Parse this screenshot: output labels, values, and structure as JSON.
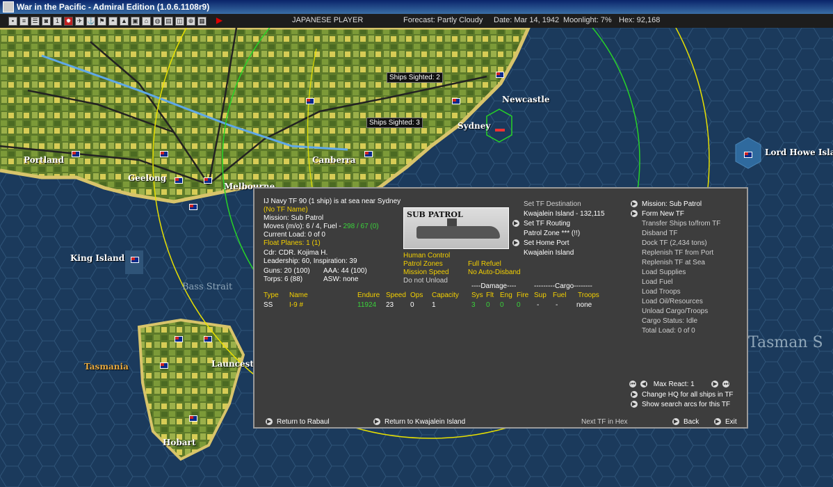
{
  "window": {
    "title": "War in the Pacific - Admiral Edition (1.0.6.1108r9)"
  },
  "toolbar": {
    "player": "JAPANESE PLAYER",
    "forecast": "Forecast: Partly Cloudy",
    "date": "Date: Mar 14, 1942",
    "moonlight": "Moonlight: 7%",
    "hex": "Hex: 92,168",
    "icons": [
      "info-icon",
      "report-icon",
      "list-icon",
      "group-icon",
      "one-icon",
      "flag-jp-icon",
      "plane-icon",
      "ship-icon",
      "intel-icon",
      "radar-icon",
      "base-icon",
      "factory-icon",
      "hq-icon",
      "globe-icon",
      "display-icon",
      "ob-icon",
      "zoom-icon",
      "save-icon",
      "play-icon"
    ]
  },
  "map": {
    "labels": {
      "portland": "Portland",
      "geelong": "Geelong",
      "melbourne": "Melbourne",
      "canberra": "Canberra",
      "sydney": "Sydney",
      "newcastle": "Newcastle",
      "lord_howe": "Lord Howe Islan",
      "king_island": "King Island",
      "bass_strait": "Bass Strait",
      "tasmania": "Tasmania",
      "launceston": "Launcesto",
      "hobart": "Hobart",
      "tasman_sea": "Tasman S"
    },
    "sightings": [
      "Ships Sighted: 2",
      "Ships Sighted: 3"
    ]
  },
  "panel": {
    "header": "IJ Navy TF 90 (1 ship) is at sea near Sydney",
    "tf_name": "(No TF Name)",
    "mission": "Mission: Sub Patrol",
    "moves_prefix": "Moves (m/o): 6 / 4, Fuel - ",
    "moves_fuel": "298 / 67 (0)",
    "current_load": "Current Load: 0 of 0",
    "float_planes": "Float Planes: 1 (1)",
    "cdr": "Cdr: CDR. Kojima H.",
    "leadership": "Leadership: 60, Inspiration: 39",
    "guns": "Guns: 20 (100)",
    "aaa": "AAA: 44 (100)",
    "torps": "Torps: 6 (88)",
    "asw": "ASW: none",
    "mission_image_title": "SUB PATROL",
    "human_control": "Human Control",
    "patrol_zones": "Patrol Zones",
    "mission_speed": "Mission Speed",
    "do_not_unload": "Do not Unload",
    "full_refuel": "Full Refuel",
    "no_auto_disband": "No Auto-Disband",
    "set_tf_destination": "Set TF Destination",
    "destination": "Kwajalein Island - 132,115",
    "set_tf_routing": "Set TF Routing",
    "patrol_zone": "Patrol Zone *** (!!)",
    "set_home_port": "Set Home Port",
    "home_port": "Kwajalein Island",
    "commands": [
      "Mission: Sub Patrol",
      "Form New TF",
      "Transfer Ships to/from TF",
      "Disband TF",
      "Dock TF (2,434 tons)",
      "Replenish TF from Port",
      "Replenish TF at Sea",
      "Load Supplies",
      "Load Fuel",
      "Load Troops",
      "Load Oil/Resources",
      "Unload Cargo/Troops",
      "Cargo Status: Idle",
      "Total Load: 0 of 0"
    ],
    "table": {
      "damage_header": "----Damage----",
      "cargo_header": "---------Cargo--------",
      "headers": [
        "Type",
        "Name",
        "Endure",
        "Speed",
        "Ops",
        "Capacity",
        "Sys",
        "Flt",
        "Eng",
        "Fire",
        "Sup",
        "Fuel",
        "Troops"
      ],
      "row": [
        "SS",
        "I-9 #",
        "11924",
        "23",
        "0",
        "1",
        "3",
        "0",
        "0",
        "0",
        "-",
        "-",
        "none"
      ]
    },
    "max_react": "Max React: 1",
    "change_hq": "Change HQ for all ships in TF",
    "show_search": "Show search arcs for this TF",
    "return_rabaul": "Return to Rabaul",
    "return_kwajalein": "Return to Kwajalein Island",
    "next_tf": "Next TF in Hex",
    "back": "Back",
    "exit": "Exit"
  },
  "colors": {
    "highlight": "#f4d000",
    "good": "#3ad33a",
    "panel_bg": "#3d3d3d",
    "sea": "#1b3a5c",
    "coast": "#d8c46a"
  }
}
